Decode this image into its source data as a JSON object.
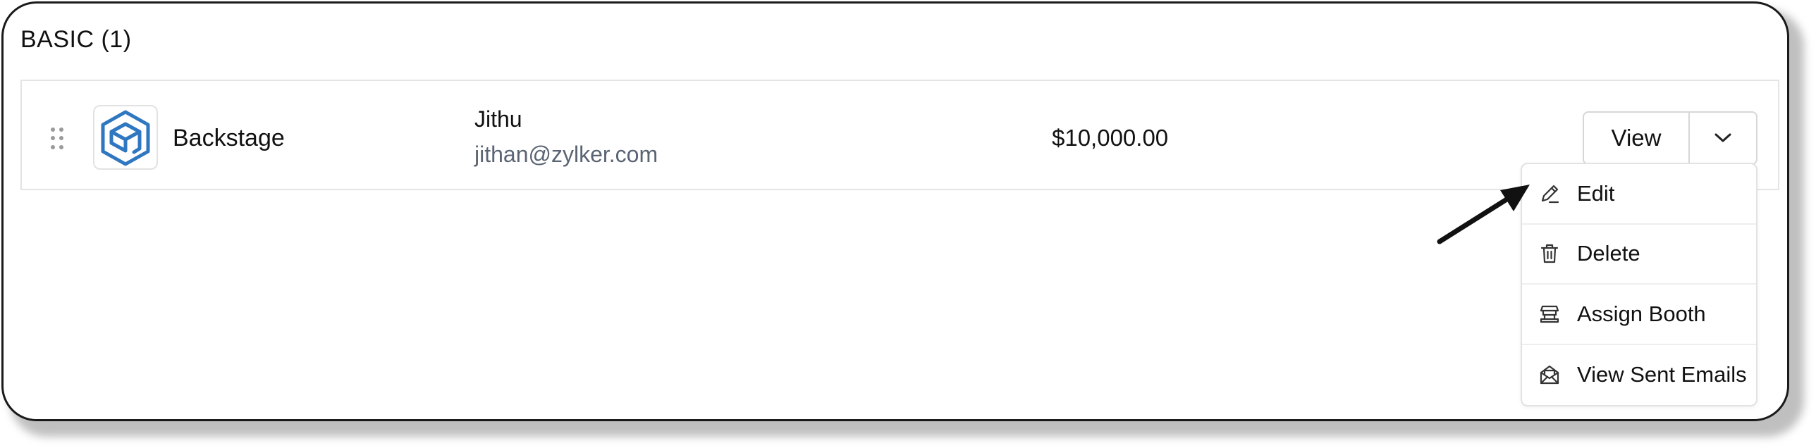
{
  "section": {
    "title": "BASIC (1)"
  },
  "row": {
    "sponsor_name": "Backstage",
    "contact_name": "Jithu",
    "contact_email": "jithan@zylker.com",
    "amount": "$10,000.00",
    "logo_icon": "backstage-logo-icon",
    "logo_color": "#2f77c0"
  },
  "actions": {
    "view_label": "View",
    "caret_icon": "chevron-down-icon"
  },
  "menu": {
    "items": [
      {
        "label": "Edit",
        "icon": "pencil-icon"
      },
      {
        "label": "Delete",
        "icon": "trash-icon"
      },
      {
        "label": "Assign Booth",
        "icon": "booth-icon"
      },
      {
        "label": "View Sent Emails",
        "icon": "mail-open-icon"
      }
    ]
  },
  "annotation": {
    "icon": "pointer-arrow-icon"
  }
}
